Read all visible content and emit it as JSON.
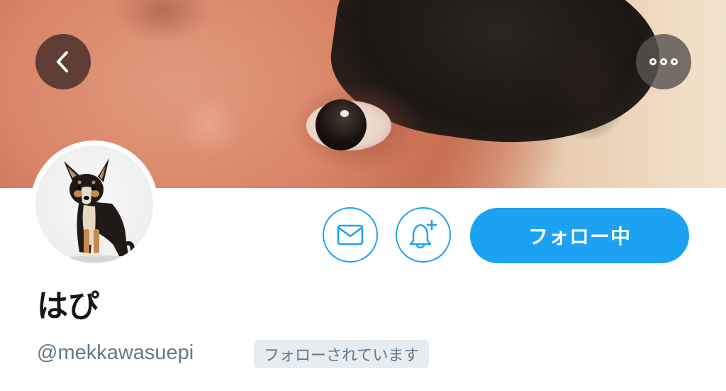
{
  "profile": {
    "display_name": "はぴ",
    "handle": "@mekkawasuepi",
    "follows_you_badge": "フォローされています"
  },
  "actions": {
    "follow_label": "フォロー中"
  },
  "icons": {
    "back": "chevron-left-icon",
    "more": "more-dots-icon",
    "message": "envelope-icon",
    "notify": "bell-plus-icon"
  },
  "colors": {
    "accent": "#1da1f2",
    "text_primary": "#14171a",
    "text_secondary": "#657786",
    "badge_bg": "#e6ecf0"
  }
}
